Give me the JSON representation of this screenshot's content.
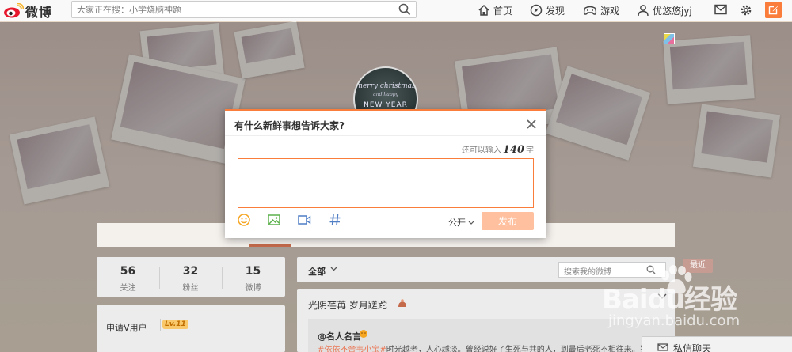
{
  "topbar": {
    "logo_text": "微博",
    "search_placeholder": "大家正在搜：小学烧脑神题",
    "nav": {
      "home": "首页",
      "discover": "发现",
      "game": "游戏",
      "user": "优悠悠jyj"
    },
    "icons": {
      "search": "search-icon",
      "home": "home-icon",
      "discover": "compass-icon",
      "game": "gamepad-icon",
      "user": "user-icon",
      "message": "mail-icon",
      "settings": "gear-icon",
      "compose": "compose-icon"
    },
    "accent_color": "#fa7d3c"
  },
  "cover": {
    "avatar_text_line1": "merry christmas",
    "avatar_text_line2": "and happy",
    "avatar_text_line3": "NEW YEAR"
  },
  "stats": [
    {
      "value": "56",
      "label": "关注"
    },
    {
      "value": "32",
      "label": "粉丝"
    },
    {
      "value": "15",
      "label": "微博"
    }
  ],
  "vcard": {
    "apply_label": "申请V用户",
    "level_badge": "Lv.11"
  },
  "feed": {
    "all_tab": "全部",
    "search_placeholder": "搜索我的微博",
    "post_title": "光阴荏苒 岁月蹉跎",
    "quote_name": "@名人名言",
    "quote_tag": "#依依不舍韦小宝#",
    "quote_text": "时光越老，人心越淡。曾经说好了生死与共的人，到最后老死不相往来。岁月"
  },
  "right": {
    "recent_label": "最近",
    "chat_label": "私信聊天"
  },
  "modal": {
    "title": "有什么新鲜事想告诉大家?",
    "counter_prefix": "还可以输入",
    "counter_value": "140",
    "counter_suffix": "字",
    "editor_value": "",
    "visibility": "公开",
    "publish_label": "发布",
    "tools": [
      "emoji-icon",
      "image-icon",
      "video-icon",
      "topic-icon"
    ]
  },
  "watermark": {
    "brand": "Baidu经验",
    "url": "jingyan.baidu.com"
  }
}
